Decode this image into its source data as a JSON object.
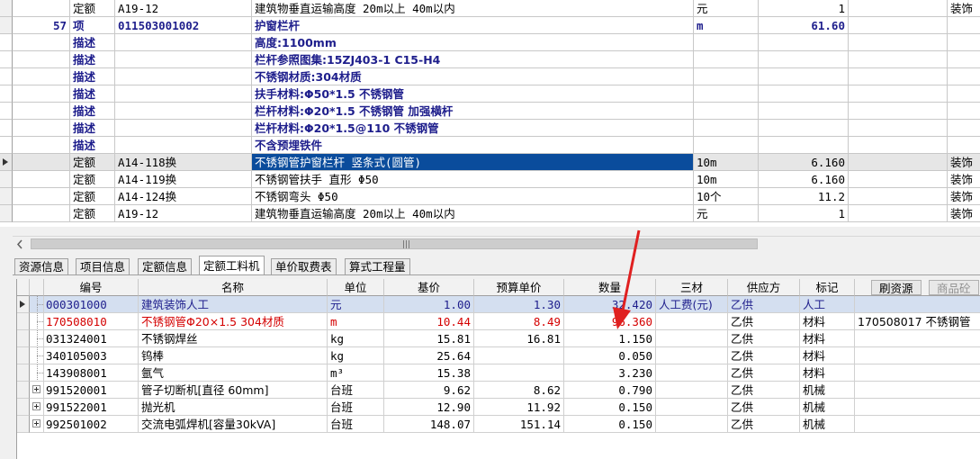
{
  "upper_rows": [
    {
      "num": "",
      "type": "定额",
      "code": "A19-12",
      "name": "建筑物垂直运输高度 20m以上 40m以内",
      "unit": "元",
      "qty": "1",
      "extra": "装饰"
    },
    {
      "num": "57",
      "type": "项",
      "code": "011503001002",
      "name": "护窗栏杆",
      "unit": "m",
      "qty": "61.60",
      "extra": ""
    },
    {
      "num": "",
      "type": "描述",
      "code": "",
      "name": "高度:1100mm",
      "unit": "",
      "qty": "",
      "extra": ""
    },
    {
      "num": "",
      "type": "描述",
      "code": "",
      "name": "栏杆参照图集:15ZJ403-1 C15-H4",
      "unit": "",
      "qty": "",
      "extra": ""
    },
    {
      "num": "",
      "type": "描述",
      "code": "",
      "name": "不锈钢材质:304材质",
      "unit": "",
      "qty": "",
      "extra": ""
    },
    {
      "num": "",
      "type": "描述",
      "code": "",
      "name": "扶手材料:Φ50*1.5 不锈钢管",
      "unit": "",
      "qty": "",
      "extra": ""
    },
    {
      "num": "",
      "type": "描述",
      "code": "",
      "name": "栏杆材料:Φ20*1.5 不锈钢管 加强横杆",
      "unit": "",
      "qty": "",
      "extra": ""
    },
    {
      "num": "",
      "type": "描述",
      "code": "",
      "name": "栏杆材料:Φ20*1.5@110 不锈钢管",
      "unit": "",
      "qty": "",
      "extra": ""
    },
    {
      "num": "",
      "type": "描述",
      "code": "",
      "name": "不含预埋铁件",
      "unit": "",
      "qty": "",
      "extra": ""
    },
    {
      "num": "",
      "type": "定额",
      "code": "A14-118换",
      "name": "不锈钢管护窗栏杆 竖条式(圆管)",
      "unit": "10m",
      "qty": "6.160",
      "extra": "装饰"
    },
    {
      "num": "",
      "type": "定额",
      "code": "A14-119换",
      "name": "不锈钢管扶手 直形 Φ50",
      "unit": "10m",
      "qty": "6.160",
      "extra": "装饰"
    },
    {
      "num": "",
      "type": "定额",
      "code": "A14-124换",
      "name": "不锈钢弯头 Φ50",
      "unit": "10个",
      "qty": "11.2",
      "extra": "装饰"
    },
    {
      "num": "",
      "type": "定额",
      "code": "A19-12",
      "name": "建筑物垂直运输高度 20m以上 40m以内",
      "unit": "元",
      "qty": "1",
      "extra": "装饰"
    }
  ],
  "tabs": [
    "资源信息",
    "项目信息",
    "定额信息",
    "定额工料机",
    "单价取费表",
    "算式工程量"
  ],
  "lower_headers": [
    "编号",
    "名称",
    "单位",
    "基价",
    "预算单价",
    "数量",
    "三材",
    "供应方",
    "标记"
  ],
  "lower_buttons": {
    "refresh": "刷资源",
    "goods": "商品砼"
  },
  "lower_rows": [
    {
      "code": "000301000",
      "name": "建筑装饰人工",
      "unit": "元",
      "base": "1.00",
      "budget": "1.30",
      "qty": "32.420",
      "sancai": "人工费(元)",
      "supplier": "乙供",
      "mark": "人工",
      "extra": ""
    },
    {
      "code": "170508010",
      "name": "不锈钢管Φ20×1.5 304材质",
      "unit": "m",
      "base": "10.44",
      "budget": "8.49",
      "qty": "96.360",
      "sancai": "",
      "supplier": "乙供",
      "mark": "材料",
      "extra": "170508017  不锈钢管"
    },
    {
      "code": "031324001",
      "name": "不锈钢焊丝",
      "unit": "kg",
      "base": "15.81",
      "budget": "16.81",
      "qty": "1.150",
      "sancai": "",
      "supplier": "乙供",
      "mark": "材料",
      "extra": ""
    },
    {
      "code": "340105003",
      "name": "钨棒",
      "unit": "kg",
      "base": "25.64",
      "budget": "",
      "qty": "0.050",
      "sancai": "",
      "supplier": "乙供",
      "mark": "材料",
      "extra": ""
    },
    {
      "code": "143908001",
      "name": "氩气",
      "unit": "m³",
      "base": "15.38",
      "budget": "",
      "qty": "3.230",
      "sancai": "",
      "supplier": "乙供",
      "mark": "材料",
      "extra": ""
    },
    {
      "code": "991520001",
      "name": "管子切断机[直径 60mm]",
      "unit": "台班",
      "base": "9.62",
      "budget": "8.62",
      "qty": "0.790",
      "sancai": "",
      "supplier": "乙供",
      "mark": "机械",
      "extra": ""
    },
    {
      "code": "991522001",
      "name": "抛光机",
      "unit": "台班",
      "base": "12.90",
      "budget": "11.92",
      "qty": "0.150",
      "sancai": "",
      "supplier": "乙供",
      "mark": "机械",
      "extra": ""
    },
    {
      "code": "992501002",
      "name": "交流电弧焊机[容量30kVA]",
      "unit": "台班",
      "base": "148.07",
      "budget": "151.14",
      "qty": "0.150",
      "sancai": "",
      "supplier": "乙供",
      "mark": "机械",
      "extra": ""
    }
  ],
  "colors": {
    "selection": "#0a4c9c",
    "highlight_text": "#d40000",
    "bold_text": "#1e1e8c",
    "annotation_arrow": "#e02020"
  }
}
